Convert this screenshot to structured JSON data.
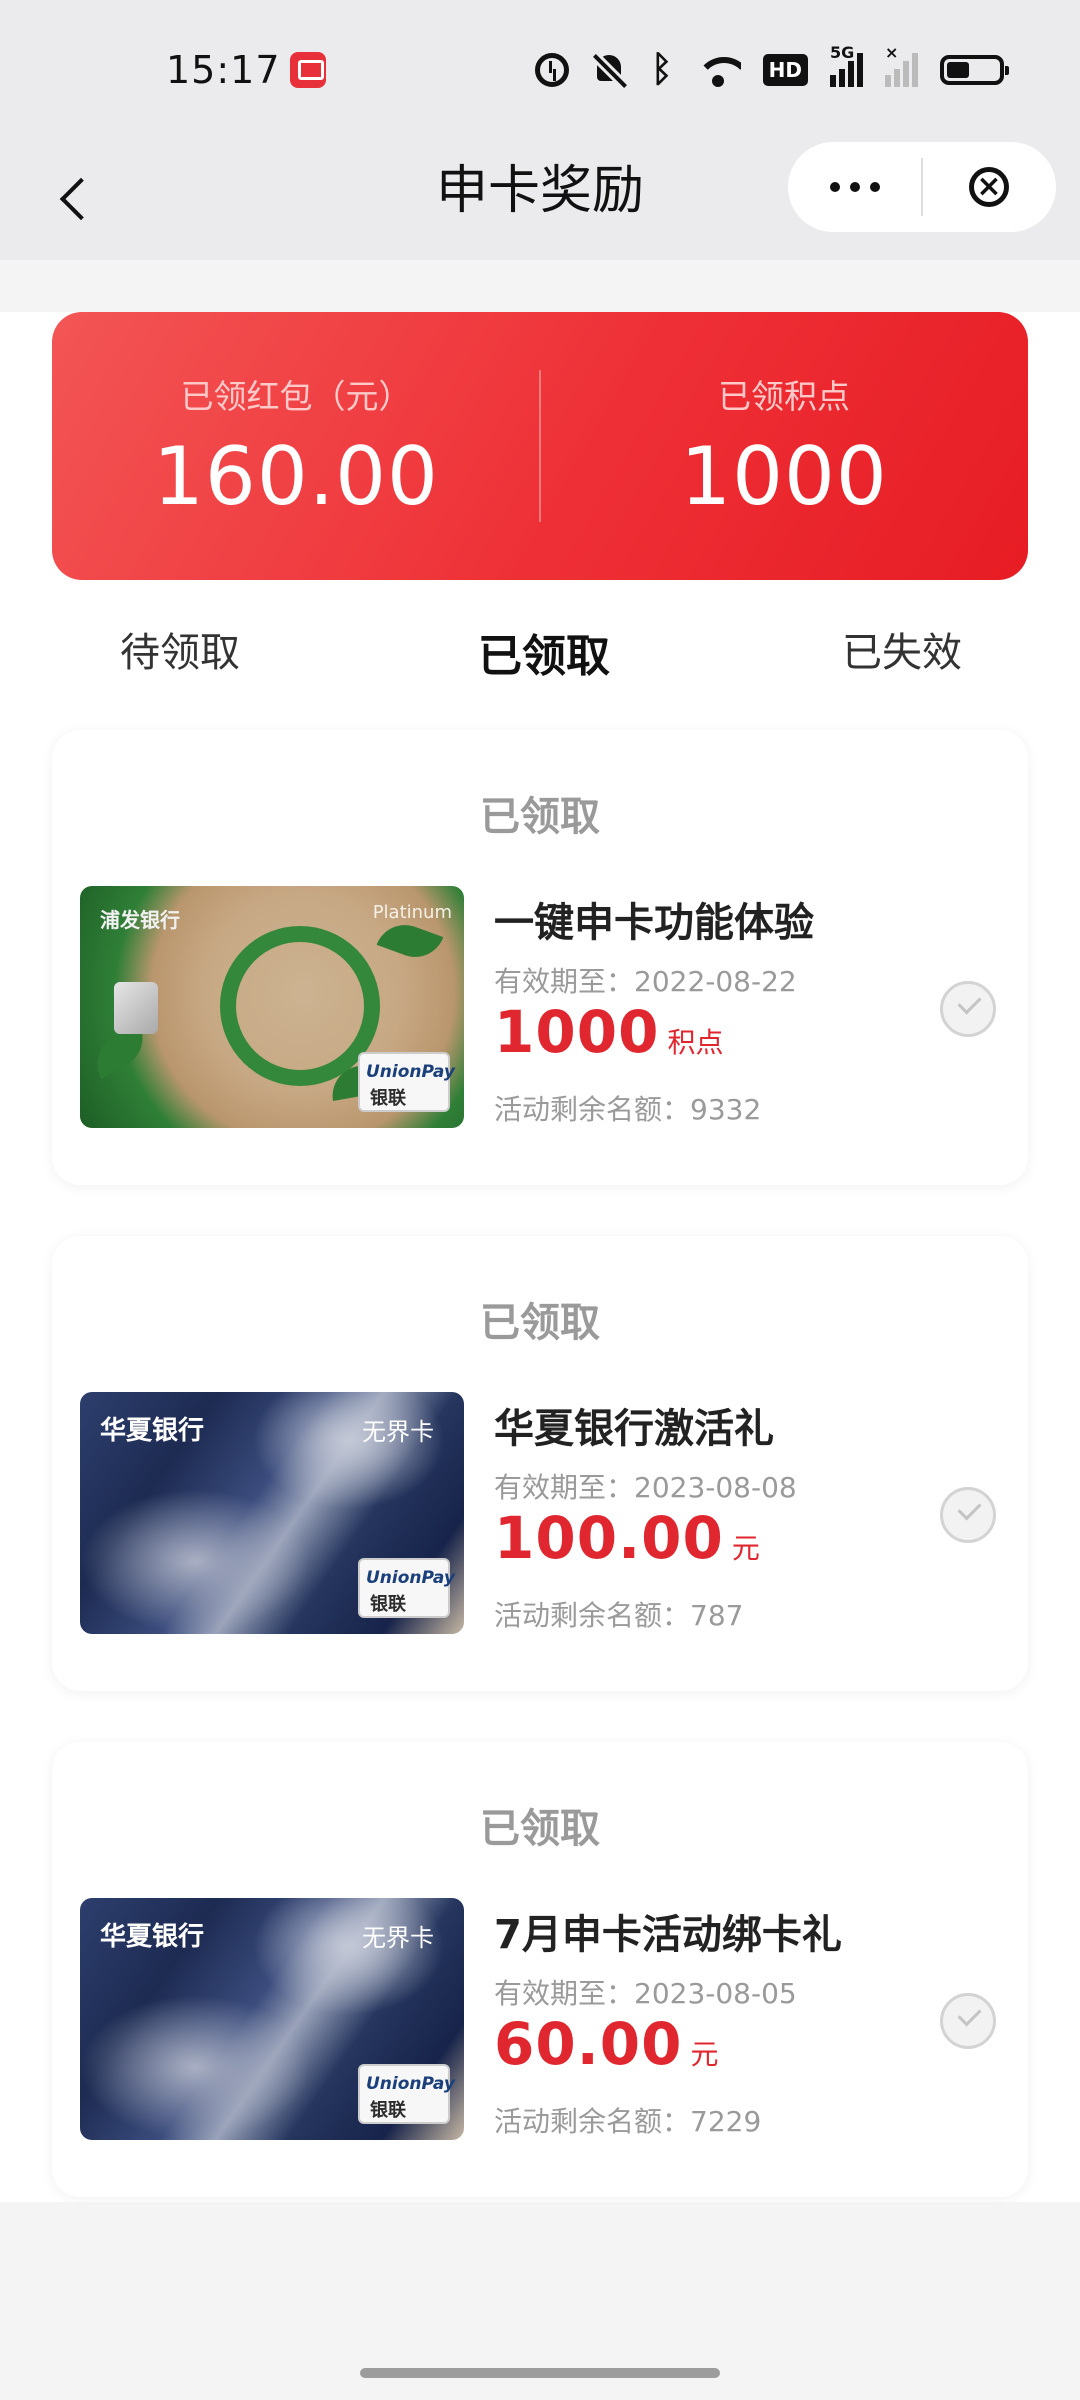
{
  "status_bar": {
    "time": "15:17",
    "app_icon": "red-app-badge-icon",
    "icons": [
      "alarm-icon",
      "mute-icon",
      "bluetooth-icon",
      "wifi-icon",
      "hd-icon",
      "signal-5g-icon",
      "signal-icon",
      "battery-icon"
    ],
    "hd_label": "HD",
    "network_label": "5G",
    "no_signal_label": "×"
  },
  "header": {
    "title": "申卡奖励",
    "back_icon": "back-arrow-icon",
    "more_icon": "more-dots-icon",
    "close_icon": "close-circle-icon"
  },
  "summary": {
    "redpacket_label": "已领红包（元）",
    "redpacket_value": "160.00",
    "points_label": "已领积点",
    "points_value": "1000"
  },
  "tabs": {
    "pending": "待领取",
    "received": "已领取",
    "expired": "已失效",
    "active": "received"
  },
  "rewards": [
    {
      "status": "已领取",
      "card_style": "spdb-green",
      "bank_mark": "浦发银行",
      "card_tag": "Platinum",
      "title": "一键申卡功能体验",
      "expiry": "有效期至：2022-08-22",
      "amount": "1000",
      "unit": "积点",
      "quota": "活动剩余名额：9332"
    },
    {
      "status": "已领取",
      "card_style": "huaxia-blue",
      "bank_mark": "华夏银行",
      "card_tag": "无界卡",
      "title": "华夏银行激活礼",
      "expiry": "有效期至：2023-08-08",
      "amount": "100.00",
      "unit": "元",
      "quota": "活动剩余名额：787"
    },
    {
      "status": "已领取",
      "card_style": "huaxia-blue",
      "bank_mark": "华夏银行",
      "card_tag": "无界卡",
      "title": "7月申卡活动绑卡礼",
      "expiry": "有效期至：2023-08-05",
      "amount": "60.00",
      "unit": "元",
      "quota": "活动剩余名额：7229"
    }
  ],
  "unionpay": {
    "en": "UnionPay",
    "cn": "银联"
  },
  "colors": {
    "accent_red": "#e0262e",
    "banner_red": "#ee3036",
    "muted_text": "#9a9a9a"
  }
}
